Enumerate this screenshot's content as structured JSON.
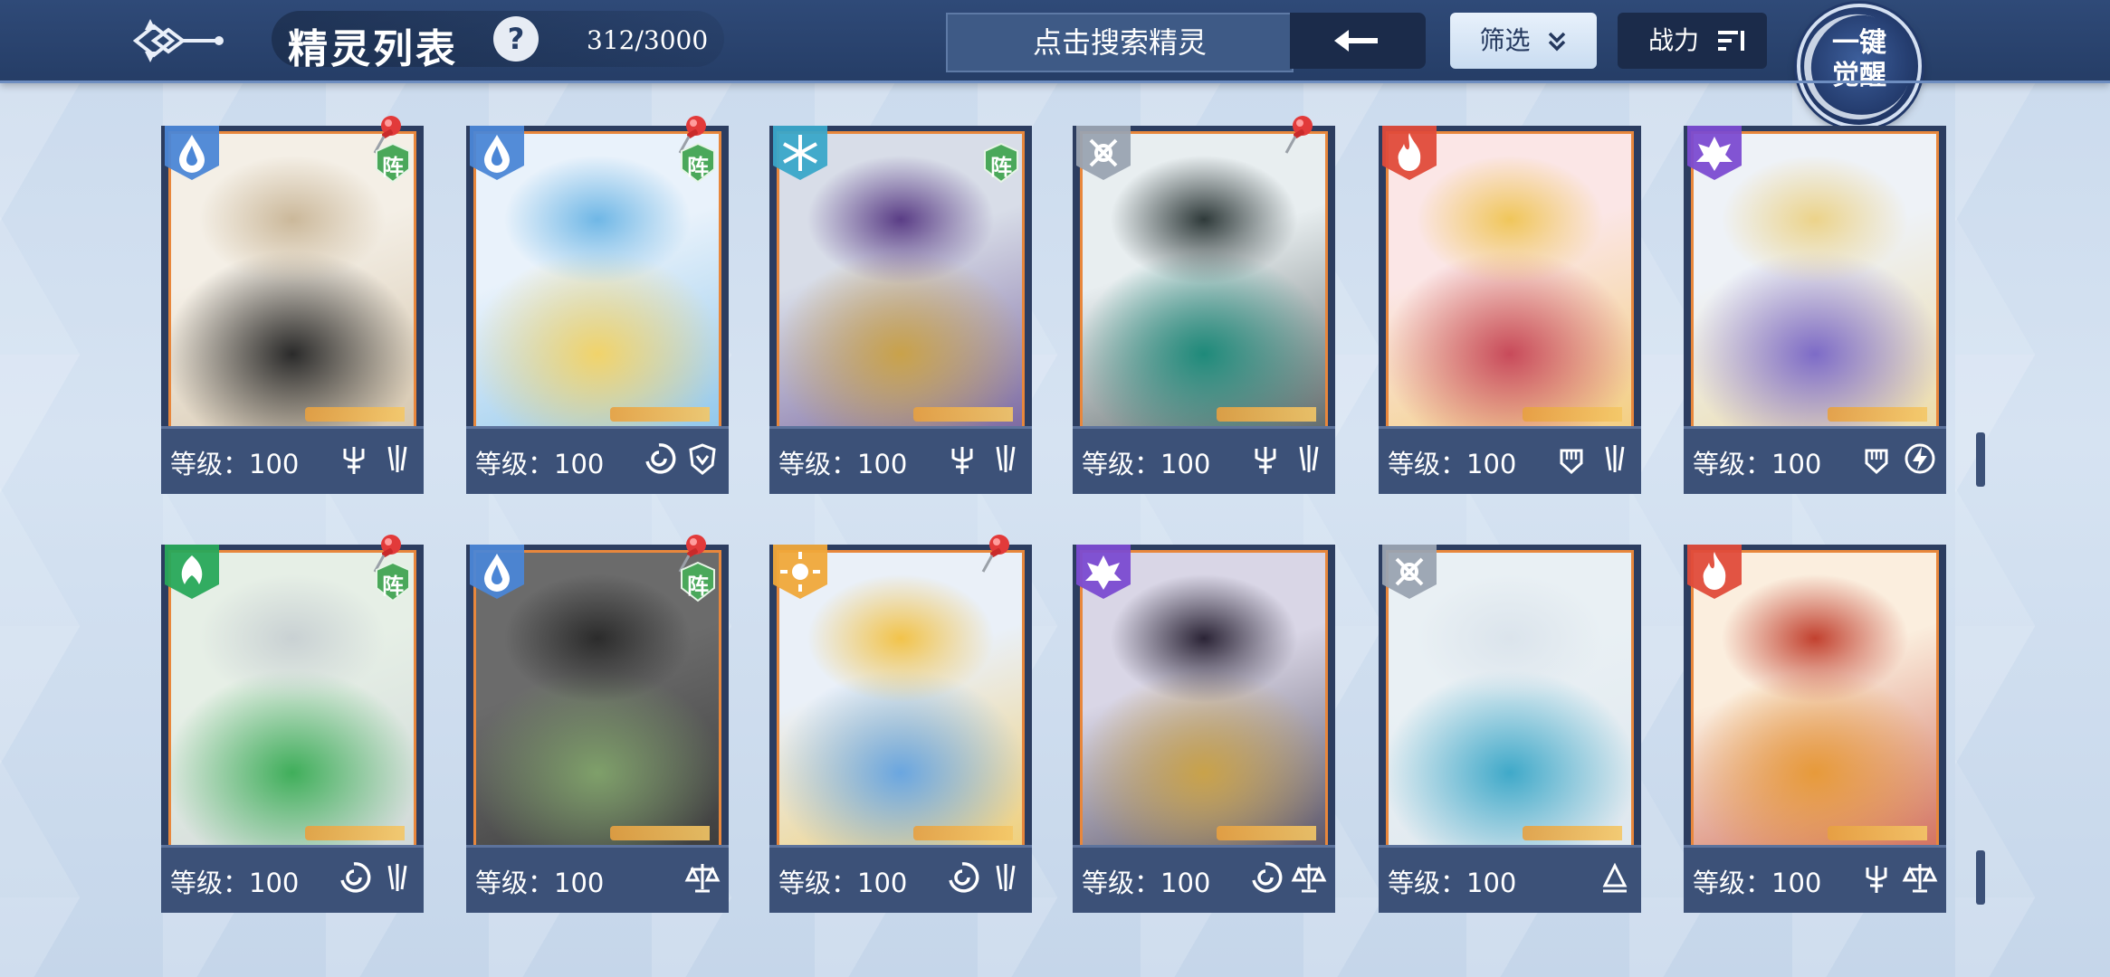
{
  "header": {
    "title": "精灵列表",
    "help_label": "?",
    "count": "312/3000",
    "search_placeholder": "点击搜索精灵",
    "filter_label": "筛选",
    "filter_icon": "double-chevron-down",
    "sort_label": "战力",
    "sort_icon": "sort-descending",
    "awaken_label": "一键觉醒",
    "back_icon": "ornate-back-emblem",
    "clear_icon": "arrow-left"
  },
  "colors": {
    "topbar": "#2f4a78",
    "card_frame": "#2c3d60",
    "card_border_orange": "#e8873c",
    "water": "#4b86d6",
    "wind": "#28a85a",
    "fire": "#e04b3a",
    "dark": "#7b4bd1",
    "light": "#f0a83a",
    "neutral": "#9aa3b1"
  },
  "level_label": "等级：",
  "cards": [
    {
      "element": "water",
      "pinned": true,
      "formation": "阵",
      "level": "100",
      "skills": [
        "trident-icon",
        "claw-icon"
      ],
      "art": [
        "#f4efe6",
        "#cbb89a",
        "#2a2a2a"
      ]
    },
    {
      "element": "water",
      "pinned": true,
      "formation": "阵",
      "level": "100",
      "skills": [
        "swirl-icon",
        "shield-icon"
      ],
      "art": [
        "#e9f2fb",
        "#6fb7e6",
        "#f1d36a"
      ]
    },
    {
      "element": "ice",
      "pinned": false,
      "formation": "阵",
      "level": "100",
      "skills": [
        "trident-icon",
        "claw-icon"
      ],
      "art": [
        "#d8dde8",
        "#5a3d86",
        "#c9a24a"
      ]
    },
    {
      "element": "neutral",
      "pinned": true,
      "formation": "",
      "level": "100",
      "skills": [
        "trident-icon",
        "claw-icon"
      ],
      "art": [
        "#e8eef0",
        "#2f3a3a",
        "#1e8a7a"
      ]
    },
    {
      "element": "fire",
      "pinned": false,
      "formation": "",
      "level": "100",
      "skills": [
        "fist-icon",
        "claw-icon"
      ],
      "art": [
        "#fbe6e6",
        "#f0c65a",
        "#c84a5a"
      ]
    },
    {
      "element": "dark",
      "pinned": false,
      "formation": "",
      "level": "100",
      "skills": [
        "fist-icon",
        "bolt-icon"
      ],
      "art": [
        "#eef2f7",
        "#ecd38a",
        "#7d6bc7"
      ]
    },
    {
      "element": "wind",
      "pinned": true,
      "formation": "阵",
      "level": "100",
      "skills": [
        "swirl-icon",
        "claw-icon"
      ],
      "art": [
        "#e6efe6",
        "#c9d1d3",
        "#3fae5a"
      ]
    },
    {
      "element": "water",
      "pinned": true,
      "formation": "阵",
      "level": "100",
      "skills": [
        "scale-icon"
      ],
      "art": [
        "#6b6b6b",
        "#2b2b2b",
        "#7fa06a"
      ]
    },
    {
      "element": "light",
      "pinned": true,
      "formation": "",
      "level": "100",
      "skills": [
        "swirl-icon",
        "claw-icon"
      ],
      "art": [
        "#eaf0f8",
        "#f2c34a",
        "#6aa6e0"
      ]
    },
    {
      "element": "dark",
      "pinned": false,
      "formation": "",
      "level": "100",
      "skills": [
        "swirl-icon",
        "scale-icon"
      ],
      "art": [
        "#d9d6e6",
        "#2b2436",
        "#c9a24a"
      ]
    },
    {
      "element": "neutral",
      "pinned": false,
      "formation": "",
      "level": "100",
      "skills": [
        "tome-icon"
      ],
      "art": [
        "#e9f0f4",
        "#dbe4ec",
        "#3fa9c9"
      ]
    },
    {
      "element": "fire",
      "pinned": false,
      "formation": "",
      "level": "100",
      "skills": [
        "trident-icon",
        "scale-icon"
      ],
      "art": [
        "#fbeede",
        "#c2412f",
        "#e79a3a"
      ]
    }
  ]
}
